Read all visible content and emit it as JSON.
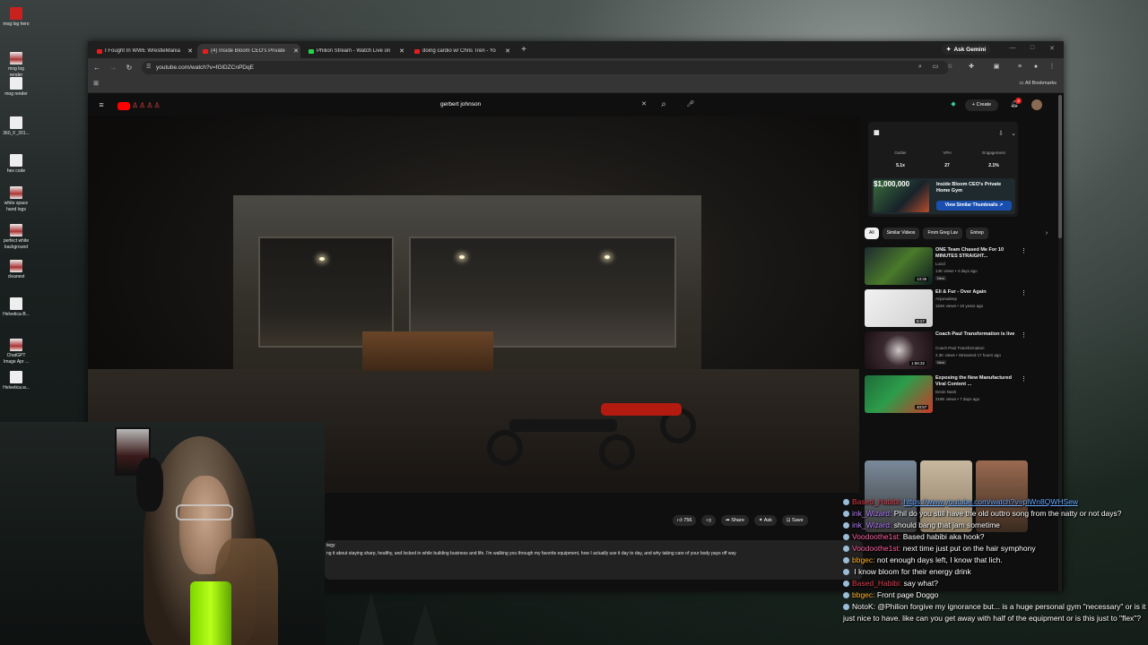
{
  "desktop_icons": [
    {
      "label": "mog log hero",
      "icon": "red-image-icon",
      "color": "#c9211e"
    },
    {
      "label": "mog log render",
      "icon": "image-icon"
    },
    {
      "label": "mog render",
      "icon": "file-icon"
    },
    {
      "label": "360_F_201...",
      "icon": "file-icon"
    },
    {
      "label": "hex code",
      "icon": "file-icon"
    },
    {
      "label": "white space hand logs",
      "icon": "image-icon"
    },
    {
      "label": "perfect white background",
      "icon": "image-icon"
    },
    {
      "label": "cleanest",
      "icon": "image-icon"
    },
    {
      "label": "Helvetica-B...",
      "icon": "file-icon"
    },
    {
      "label": "ChatGPT Image Apr ...",
      "icon": "image-icon"
    },
    {
      "label": "Helvetica.w...",
      "icon": "file-icon"
    }
  ],
  "browser": {
    "tabs": [
      {
        "label": "I Fought In WWE WrestleMania",
        "icon": "youtube-icon"
      },
      {
        "label": "(4) Inside Bloom CEO's Private",
        "icon": "youtube-icon",
        "active": true
      },
      {
        "label": "Philion Stream - Watch Live on",
        "icon": "kick-icon"
      },
      {
        "label": "doing cardio w/ Chris Tren - Yo",
        "icon": "youtube-icon"
      }
    ],
    "gemini_label": "Ask Gemini",
    "url": "youtube.com/watch?v=fGlDZCnPDqE",
    "all_bookmarks": "All Bookmarks"
  },
  "youtube": {
    "search_value": "gerbert johnson",
    "create_label": "Create",
    "notifications": "4",
    "actions": {
      "like_count": "756",
      "share": "Share",
      "ask": "Ask",
      "save": "Save"
    },
    "description": "ng it about staying sharp, healthy, and locked in while building business and life. I'm walking you through my favorite equipment, how I actually use it day to day, and why taking care of your body pays off way",
    "description_prefix": "tegy"
  },
  "extension": {
    "stats": [
      {
        "label": "Outlier",
        "value": "5.1x"
      },
      {
        "label": "VPH",
        "value": "27"
      },
      {
        "label": "Engagement",
        "value": "2.1%"
      }
    ],
    "thumb_price": "$1,000,000",
    "thumb_title": "Inside Bloom CEO's Private Home Gym",
    "similar_button": "View Similar Thumbnails"
  },
  "chips": [
    "All",
    "Similar Videos",
    "From Greg Lav",
    "Entrep"
  ],
  "recommendations": [
    {
      "title": "ONE Team Chased Me For 10 MINUTES STRAIGHT...",
      "channel": "Lucid",
      "meta": "14K views • 4 days ago",
      "badge": "New",
      "duration": "13:35"
    },
    {
      "title": "Eli & Fur - Over Again",
      "channel": "Anjunadeep",
      "meta": "154K views • 10 years ago",
      "badge": "",
      "duration": "5:17"
    },
    {
      "title": "Coach Paul Transformation is live",
      "channel": "Coach Paul Transformation",
      "meta": "2.3K views • Streamed 17 hours ago",
      "badge": "New",
      "duration": "1:56:32"
    },
    {
      "title": "Exposing the New Manufactured Viral Content ...",
      "channel": "Devin Nash",
      "meta": "218K views • 7 days ago",
      "badge": "",
      "duration": "40:57"
    }
  ],
  "chat": [
    {
      "user": "Based_Habibi:",
      "text": "https://www.youtube.com/watch?v=plWn8QWHSew",
      "user_color": "#e23c4c",
      "link": true
    },
    {
      "user": "ink_Wizard:",
      "text": "Phil do you still have the old outtro song from the natty or not days?",
      "user_color": "#b57cff"
    },
    {
      "user": "ink_Wizard:",
      "text": "should bang that jam sometime",
      "user_color": "#b57cff"
    },
    {
      "user": "Voodoothe1st:",
      "text": "Based habibi aka hook?",
      "user_color": "#ff5fa0"
    },
    {
      "user": "Voodoothe1st:",
      "text": "next time just put on the hair symphony",
      "user_color": "#ff5fa0"
    },
    {
      "user": "bbgec:",
      "text": "not enough days left, I know that lich.",
      "user_color": "#ffb22e"
    },
    {
      "user": "",
      "text": "I know bloom for their energy drink",
      "user_color": "#ff3a3a"
    },
    {
      "user": "Based_Habibi:",
      "text": "say what?",
      "user_color": "#e23c4c"
    },
    {
      "user": "bbgec:",
      "text": "Front page Doggo",
      "user_color": "#ffb22e"
    },
    {
      "user": "NotoK:",
      "text": "@Philion forgive my ignorance but... is a huge personal gym \"necessary\" or is it just nice to have. like can you get away with half of the equipment or is this just to \"flex\"?",
      "user_color": "#ffffff"
    }
  ]
}
